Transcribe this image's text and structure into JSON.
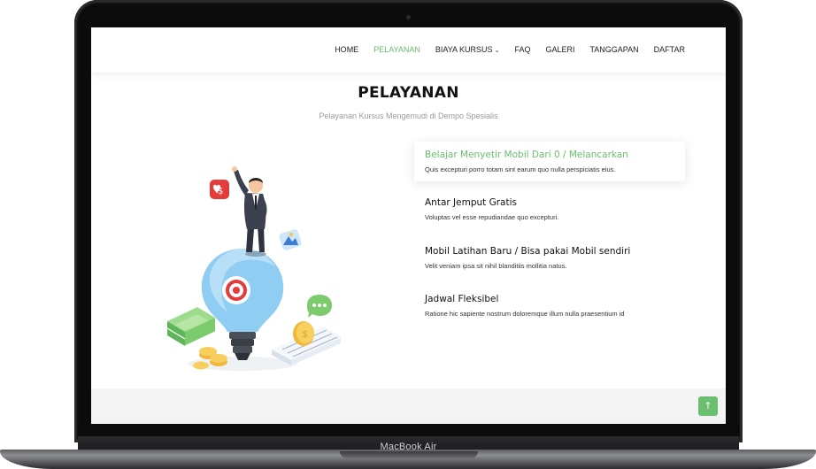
{
  "device": {
    "label": "MacBook Air"
  },
  "nav": {
    "items": [
      {
        "label": "HOME"
      },
      {
        "label": "PELAYANAN"
      },
      {
        "label": "BIAYA KURSUS"
      },
      {
        "label": "FAQ"
      },
      {
        "label": "GALERI"
      },
      {
        "label": "TANGGAPAN"
      },
      {
        "label": "DAFTAR"
      }
    ],
    "active_index": 1,
    "dropdown_index": 2
  },
  "section": {
    "title": "PELAYANAN",
    "subtitle": "Pelayanan Kursus Mengemudi di Dempo Spesialis"
  },
  "services": [
    {
      "title": "Belajar Menyetir Mobil Dari 0 / Melancarkan",
      "desc": "Quis excepturi porro totam sint earum quo nulla perspiciatis eius."
    },
    {
      "title": "Antar Jemput Gratis",
      "desc": "Voluptas vel esse repudiandae quo excepturi."
    },
    {
      "title": "Mobil Latihan Baru / Bisa pakai Mobil sendiri",
      "desc": "Velit veniam ipsa sit nihil blanditiis mollitia natus."
    },
    {
      "title": "Jadwal Fleksibel",
      "desc": "Ratione hic sapiente nostrum doloremque illum nulla praesentium id"
    }
  ],
  "colors": {
    "accent": "#6bbf6e",
    "heading": "#111111",
    "muted": "#9a9a9a",
    "footer": "#f4f4f4"
  },
  "icons": {
    "back_to_top": "arrow-up-icon",
    "dropdown": "chevron-down-icon"
  }
}
